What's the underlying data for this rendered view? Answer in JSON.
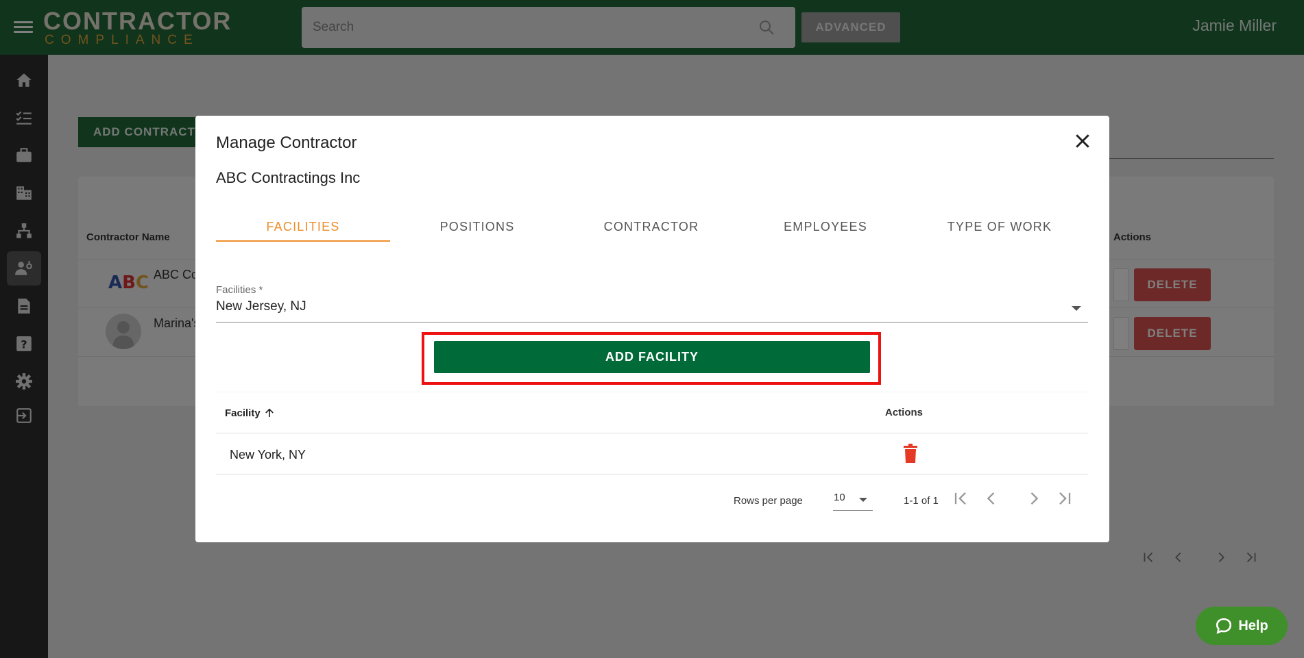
{
  "app": {
    "logo_line1": "CONTRACTOR",
    "logo_line2": "COMPLIANCE",
    "search_placeholder": "Search",
    "advanced_label": "ADVANCED",
    "user_name": "Jamie Miller"
  },
  "sidebar": {
    "items": [
      {
        "icon": "home-icon"
      },
      {
        "icon": "checklist-icon"
      },
      {
        "icon": "briefcase-icon"
      },
      {
        "icon": "building-icon"
      },
      {
        "icon": "hierarchy-icon"
      },
      {
        "icon": "contractor-icon",
        "active": true
      },
      {
        "icon": "document-icon"
      },
      {
        "icon": "help-icon"
      },
      {
        "icon": "gear-icon"
      },
      {
        "icon": "logout-icon"
      }
    ]
  },
  "background": {
    "add_button": "ADD CONTRACTOR",
    "col_name": "Contractor Name",
    "col_actions": "Actions",
    "rows": [
      {
        "name": "ABC Co",
        "delete": "DELETE"
      },
      {
        "name": "Marina's",
        "delete": "DELETE"
      }
    ]
  },
  "modal": {
    "title": "Manage Contractor",
    "subtitle": "ABC Contractings Inc",
    "tabs": [
      "FACILITIES",
      "POSITIONS",
      "CONTRACTOR",
      "EMPLOYEES",
      "TYPE OF WORK"
    ],
    "active_tab": "FACILITIES",
    "facilities_label": "Facilities *",
    "facilities_value": "New Jersey, NJ",
    "add_facility_label": "ADD FACILITY",
    "table": {
      "col_facility": "Facility",
      "col_actions": "Actions",
      "rows": [
        {
          "facility": "New York, NY"
        }
      ]
    },
    "pagination": {
      "rows_per_page_label": "Rows per page",
      "rows_per_page": "10",
      "range": "1-1 of 1"
    }
  },
  "help": {
    "label": "Help"
  },
  "colors": {
    "brand": "#22683a",
    "accent": "#ee8e2a",
    "danger": "#d9534f",
    "help": "#3f8f2a"
  }
}
